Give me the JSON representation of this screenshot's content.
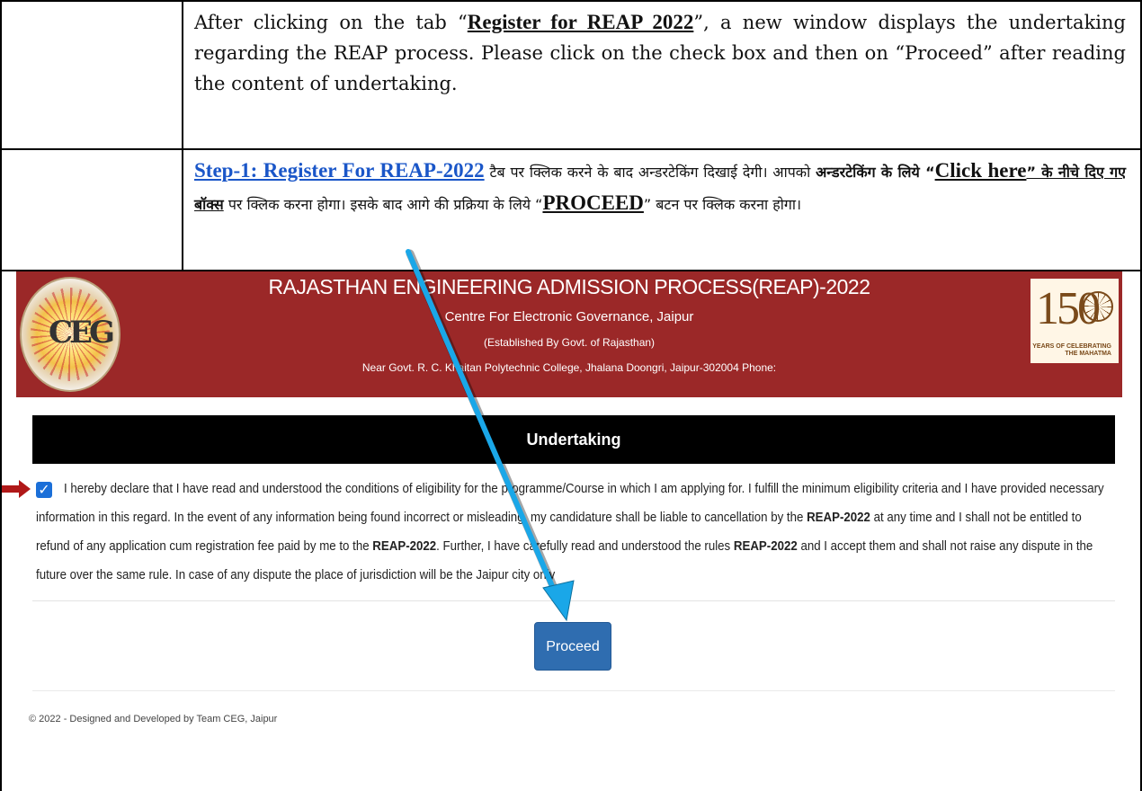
{
  "instructions": {
    "row1": {
      "part1": "After clicking on the tab “",
      "tab_name": "Register for REAP 2022",
      "part2": "”, a new window displays the undertaking regarding the REAP process. Please click on the check box and then on “Proceed” after reading the content of undertaking."
    },
    "row2": {
      "link": "Step-1: Register For REAP-2022",
      "t1": " टैब पर क्लिक करने के बाद अन्डरटेकिंग दिखाई देगी। आपको ",
      "t2_bold": "अन्डरटेकिंग के लिये “",
      "click_here": "Click here",
      "t3_bold": "” के नीचे दिए गए बॉक्स",
      "t4": " पर क्लिक करना होगा। इसके बाद आगे की प्रक्रिया के लिये “",
      "proceed_word": "PROCEED",
      "t5": "” बटन पर क्लिक करना होगा।"
    }
  },
  "header": {
    "title": "RAJASTHAN ENGINEERING ADMISSION PROCESS(REAP)-2022",
    "subtitle": "Centre For Electronic Governance, Jaipur",
    "established": "(Established By Govt. of Rajasthan)",
    "address": "Near Govt. R. C. Khaitan Polytechnic College, Jhalana Doongri, Jaipur-302004 Phone:",
    "left_logo_text": "CEG",
    "right_logo_number": "150",
    "right_logo_caption": "YEARS OF CELEBRATING THE MAHATMA",
    "background_color": "#9b2828"
  },
  "undertaking": {
    "title": "Undertaking",
    "checked": true,
    "declaration_part1": "I hereby declare that I have read and understood the conditions of eligibility for the programme/Course in which I am applying for. I fulfill the minimum eligibility criteria and I have provided necessary information in this regard. In the event of any information being found incorrect or misleading, my candidature shall be liable to cancellation by the ",
    "declaration_bold1": "REAP-2022",
    "declaration_part2": " at any time and I shall not be entitled to refund of any application cum registration fee paid by me to the ",
    "declaration_bold2": "REAP-2022",
    "declaration_part3": ". Further, I have carefully read and understood the rules ",
    "declaration_bold3": "REAP-2022",
    "declaration_part4": " and I accept them and shall not raise any dispute in the future over the same rule. In case of any dispute the place of jurisdiction will be the Jaipur city only"
  },
  "proceed_button": {
    "label": "Proceed",
    "color": "#2f6db0"
  },
  "footer": {
    "text": "© 2022 - Designed and Developed by Team CEG, Jaipur"
  },
  "annotation": {
    "arrow_color": "#1aa7e8",
    "marker_color": "#b01818"
  }
}
